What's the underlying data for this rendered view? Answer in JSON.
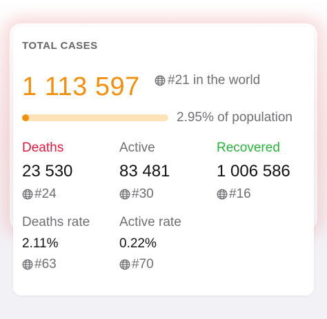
{
  "header": {
    "title": "TOTAL CASES"
  },
  "total": {
    "value": "1 113 597",
    "world_rank": "#21 in the world"
  },
  "population": {
    "progress_fraction": 0.0295,
    "text": "2.95% of population"
  },
  "stats": {
    "deaths": {
      "label": "Deaths",
      "value": "23 530",
      "rank": "#24"
    },
    "active": {
      "label": "Active",
      "value": "83 481",
      "rank": "#30"
    },
    "recovered": {
      "label": "Recovered",
      "value": "1 006 586",
      "rank": "#16"
    },
    "deaths_rate": {
      "label": "Deaths rate",
      "value": "2.11%",
      "rank": "#63"
    },
    "active_rate": {
      "label": "Active rate",
      "value": "0.22%",
      "rank": "#70"
    }
  },
  "colors": {
    "accent_orange": "#f58f0a",
    "progress_track": "#fde2b8",
    "deaths_red": "#e5173f",
    "recovered_green": "#28b43a",
    "secondary_text": "#6e6e73"
  },
  "icons": {
    "rank_icon": "globe-icon"
  }
}
